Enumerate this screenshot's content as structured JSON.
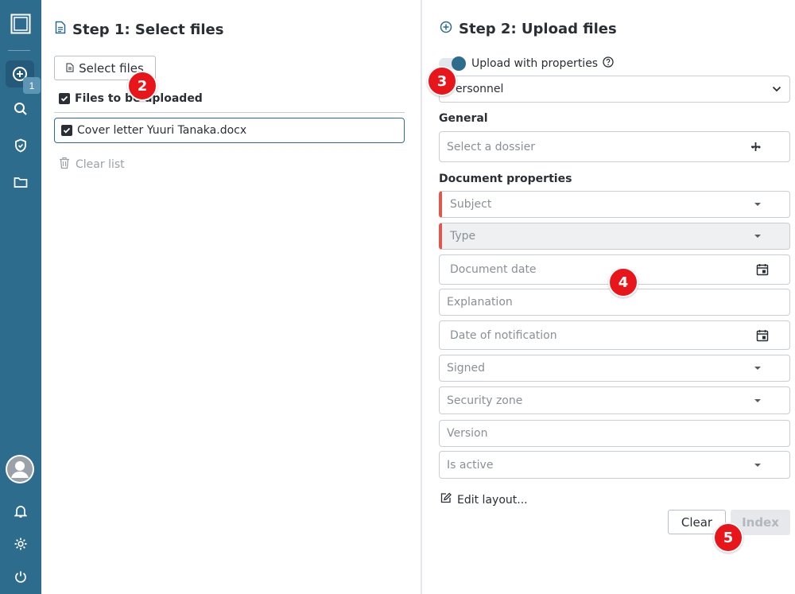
{
  "sidebar": {
    "badge_count": "1",
    "items": [
      {
        "icon": "logo-icon"
      },
      {
        "icon": "add-circle-icon"
      },
      {
        "icon": "search-icon"
      },
      {
        "icon": "shield-icon"
      },
      {
        "icon": "folder-icon"
      },
      {
        "icon": "avatar-icon"
      },
      {
        "icon": "bell-icon"
      },
      {
        "icon": "gear-icon"
      },
      {
        "icon": "power-icon"
      }
    ]
  },
  "step1": {
    "title": "Step 1: Select files",
    "select_button": "Select files",
    "files_header": "Files to be uploaded",
    "files": [
      {
        "name": "Cover letter Yuuri Tanaka.docx",
        "checked": true
      }
    ],
    "clear_list": "Clear list"
  },
  "step2": {
    "title": "Step 2: Upload files",
    "toggle_label": "Upload with properties",
    "toggle_on": true,
    "category_value": "Personnel",
    "general_label": "General",
    "dossier_placeholder": "Select a dossier",
    "doc_props_label": "Document properties",
    "fields": {
      "subject": "Subject",
      "type": "Type",
      "document_date": "Document date",
      "explanation": "Explanation",
      "date_of_notification": "Date of notification",
      "signed": "Signed",
      "security_zone": "Security zone",
      "version": "Version",
      "is_active": "Is active"
    },
    "edit_layout": "Edit layout...",
    "clear_button": "Clear",
    "index_button": "Index"
  },
  "markers": [
    "2",
    "3",
    "4",
    "5"
  ],
  "colors": {
    "rail": "#2e6c8e",
    "accent": "#2e6c8e",
    "required": "#e2574c",
    "marker": "#e8151b"
  }
}
